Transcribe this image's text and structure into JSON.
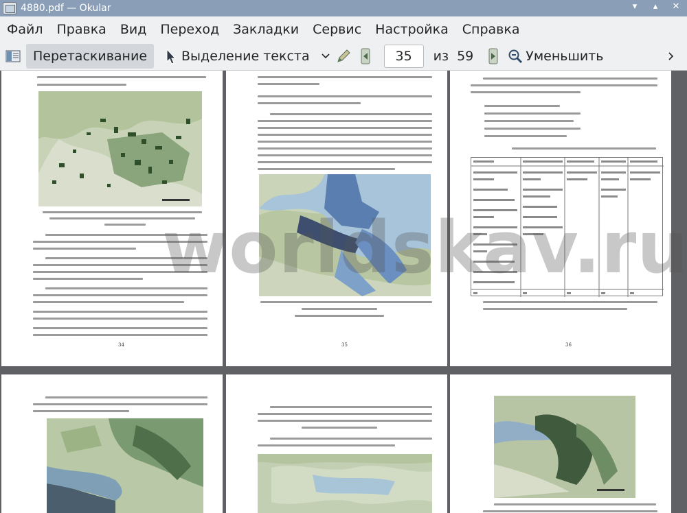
{
  "window": {
    "title": "4880.pdf — Okular"
  },
  "menu": [
    "Файл",
    "Правка",
    "Вид",
    "Переход",
    "Закладки",
    "Сервис",
    "Настройка",
    "Справка"
  ],
  "toolbar": {
    "drag_label": "Перетаскивание",
    "select_label": "Выделение текста",
    "current_page": "35",
    "of_label": "из",
    "total_pages": "59",
    "zoom_out_label": "Уменьшить"
  },
  "pages": [
    {
      "number": "34"
    },
    {
      "number": "35"
    },
    {
      "number": "36"
    }
  ],
  "watermark": {
    "text": "worldskav.ru"
  }
}
